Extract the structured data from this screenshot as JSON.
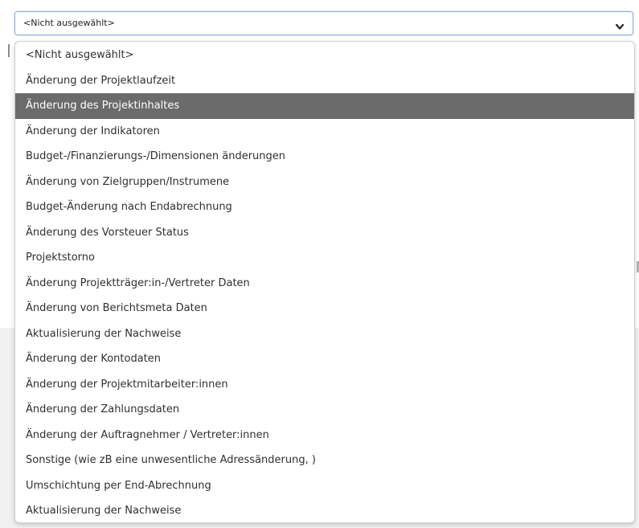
{
  "select": {
    "current_value": "<Nicht ausgewählt>",
    "chevron_icon": "chevron-down-icon"
  },
  "dropdown": {
    "highlighted_index": 2,
    "highlight_color": "#6b6b6b",
    "options": [
      "<Nicht ausgewählt>",
      "Änderung der Projektlaufzeit",
      "Änderung des Projektinhaltes",
      "Änderung der Indikatoren",
      "Budget-/Finanzierungs-/Dimensionen änderungen",
      "Änderung von Zielgruppen/Instrumene",
      "Budget-Änderung nach Endabrechnung",
      "Änderung des Vorsteuer Status",
      "Projektstorno",
      "Änderung Projektträger:in-/Vertreter Daten",
      "Änderung von Berichtsmeta Daten",
      "Aktualisierung der Nachweise",
      "Änderung der Kontodaten",
      "Änderung der Projektmitarbeiter:innen",
      "Änderung der Zahlungsdaten",
      "Änderung der Auftragnehmer / Vertreter:innen",
      "Sonstige (wie zB eine unwesentliche Adressänderung, )",
      "Umschichtung per End-Abrechnung",
      "Aktualisierung der Nachweise"
    ]
  }
}
